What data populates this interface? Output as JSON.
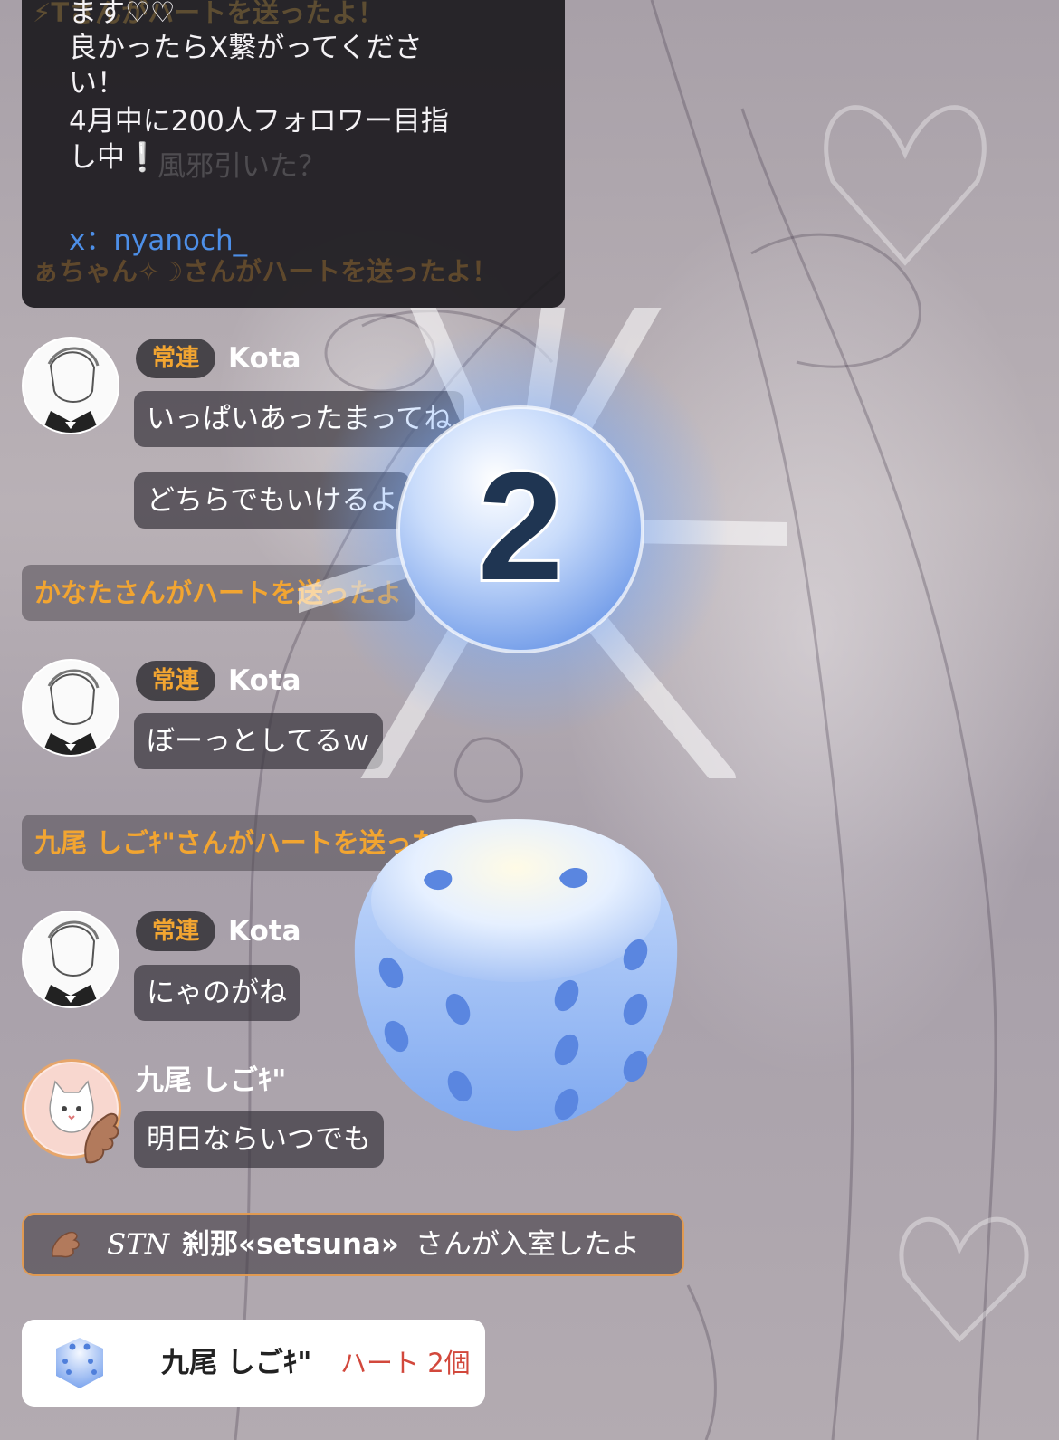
{
  "pinned_message": {
    "lines": [
      "ます♡♡",
      "良かったらX繋がってくださ",
      "い！",
      "4月中に200人フォロワー目指",
      "し中❕",
      "",
      "x：nyanoch_"
    ]
  },
  "behind_text": {
    "top": "⚡Tさんがハートを送ったよ！",
    "mid": "風邪引いた？",
    "lower": "ぁちゃん✧☽さんがハートを送ったよ！"
  },
  "chat": [
    {
      "badge": "常連",
      "name": "Kota",
      "messages": [
        "いっぱいあったまってね",
        "どちらでもいけるよ"
      ]
    },
    {
      "heart": "かなたさんがハートを送ったよ"
    },
    {
      "badge": "常連",
      "name": "Kota",
      "messages": [
        "ぼーっとしてるｗ"
      ]
    },
    {
      "heart": "九尾 しごｷ\"さんがハートを送ったよ"
    },
    {
      "badge": "常連",
      "name": "Kota",
      "messages": [
        "にゃのがね"
      ]
    },
    {
      "name": "九尾 しごｷ\"",
      "messages": [
        "明日ならいつでも"
      ]
    }
  ],
  "entry_notice": {
    "script_tag": "STN",
    "name": "刹那«setsuna»",
    "suffix": "さんが入室したよ"
  },
  "gift_toast": {
    "sender": "九尾 しごｷ\"",
    "item": "ハート 2個"
  },
  "dice_roll": {
    "result": "2"
  },
  "colors": {
    "badge_text": "#f2a531",
    "link": "#4d8fe8",
    "gift_item": "#d2483c",
    "entry_border": "#e09a52"
  }
}
